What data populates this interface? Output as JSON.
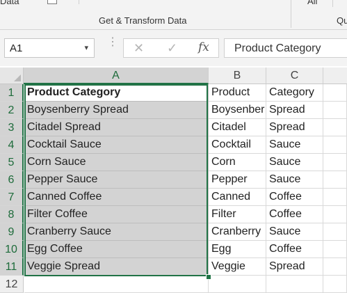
{
  "ribbon": {
    "left_fragment": "Data",
    "group_label": "Get & Transform Data",
    "right_fragment_1": "All",
    "right_fragment_2": "Qu"
  },
  "formula_bar": {
    "name_box": "A1",
    "name_box_arrow": "▾",
    "cancel_icon": "✕",
    "enter_icon": "✓",
    "fx_label": "fx",
    "value": "Product Category"
  },
  "sheet": {
    "columns": [
      "A",
      "B",
      "C"
    ],
    "rows": [
      "1",
      "2",
      "3",
      "4",
      "5",
      "6",
      "7",
      "8",
      "9",
      "10",
      "11",
      "12"
    ],
    "cells": [
      [
        "Product Category",
        "Product",
        "Category"
      ],
      [
        "Boysenberry Spread",
        "Boysenber",
        "Spread"
      ],
      [
        "Citadel Spread",
        "Citadel",
        "Spread"
      ],
      [
        "Cocktail Sauce",
        "Cocktail",
        "Sauce"
      ],
      [
        "Corn Sauce",
        "Corn",
        "Sauce"
      ],
      [
        "Pepper Sauce",
        "Pepper",
        "Sauce"
      ],
      [
        "Canned Coffee",
        "Canned",
        "Coffee"
      ],
      [
        "Filter Coffee",
        "Filter",
        "Coffee"
      ],
      [
        "Cranberry Sauce",
        "Cranberry",
        "Sauce"
      ],
      [
        "Egg Coffee",
        "Egg",
        "Coffee"
      ],
      [
        "Veggie Spread",
        "Veggie",
        "Spread"
      ]
    ]
  },
  "colors": {
    "accent_green": "#217346",
    "selection_fill": "#d3d3d3"
  }
}
